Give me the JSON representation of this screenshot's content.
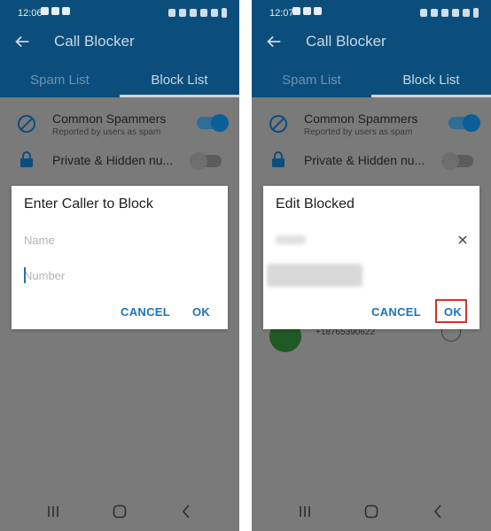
{
  "screens": [
    {
      "status_time": "12:06",
      "title": "Call Blocker",
      "tabs": [
        "Spam List",
        "Block List"
      ],
      "settings": [
        {
          "label": "Common Spammers",
          "sublabel": "Reported by users as spam",
          "icon": "block-icon",
          "toggle": "on"
        },
        {
          "label": "Private & Hidden nu...",
          "sublabel": "",
          "icon": "lock-icon",
          "toggle": "off"
        }
      ],
      "dialog": {
        "title": "Enter Caller to Block",
        "name_placeholder": "Name",
        "number_placeholder": "Number",
        "cancel": "CANCEL",
        "ok": "OK"
      }
    },
    {
      "status_time": "12:07",
      "title": "Call Blocker",
      "tabs": [
        "Spam List",
        "Block List"
      ],
      "settings": [
        {
          "label": "Common Spammers",
          "sublabel": "Reported by users as spam",
          "icon": "block-icon",
          "toggle": "on"
        },
        {
          "label": "Private & Hidden nu...",
          "sublabel": "",
          "icon": "lock-icon",
          "toggle": "off"
        }
      ],
      "dialog": {
        "title": "Edit Blocked",
        "cancel": "CANCEL",
        "ok": "OK"
      },
      "list_behind": {
        "number": "+18765390622"
      }
    }
  ],
  "colors": {
    "primary": "#0b4e7c",
    "accent": "#1e73b3",
    "highlight": "#d0342c"
  }
}
